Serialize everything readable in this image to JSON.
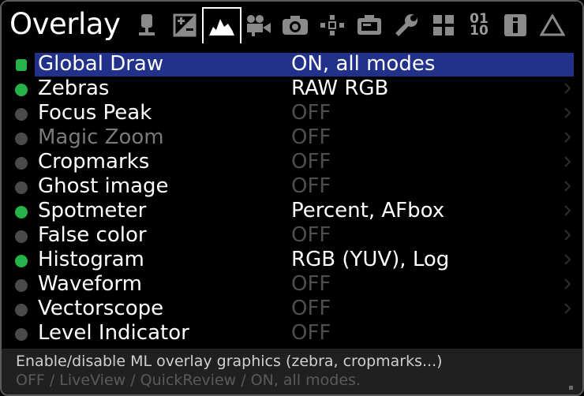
{
  "header": {
    "title": "Overlay",
    "tabs": [
      {
        "name": "audio-mic-icon"
      },
      {
        "name": "exposure-icon"
      },
      {
        "name": "overlay-histogram-icon",
        "active": true
      },
      {
        "name": "movie-camera-icon"
      },
      {
        "name": "photo-camera-icon"
      },
      {
        "name": "focus-icon"
      },
      {
        "name": "display-icon"
      },
      {
        "name": "wrench-icon"
      },
      {
        "name": "modules-icon"
      },
      {
        "name": "debug-icon",
        "text_top": "01",
        "text_bottom": "10"
      },
      {
        "name": "info-icon",
        "text": "i"
      },
      {
        "name": "warning-icon"
      }
    ]
  },
  "menu": {
    "items": [
      {
        "label": "Global Draw",
        "value": "ON, all modes",
        "state": "on-square",
        "selected": true
      },
      {
        "label": "Zebras",
        "value": "RAW RGB",
        "state": "on"
      },
      {
        "label": "Focus Peak",
        "value": "OFF",
        "state": "off"
      },
      {
        "label": "Magic Zoom",
        "value": "OFF",
        "state": "off",
        "disabled": true
      },
      {
        "label": "Cropmarks",
        "value": "OFF",
        "state": "off"
      },
      {
        "label": "Ghost image",
        "value": "OFF",
        "state": "off"
      },
      {
        "label": "Spotmeter",
        "value": "Percent, AFbox",
        "state": "on"
      },
      {
        "label": "False color",
        "value": "OFF",
        "state": "off"
      },
      {
        "label": "Histogram",
        "value": "RGB (YUV), Log",
        "state": "on"
      },
      {
        "label": "Waveform",
        "value": "OFF",
        "state": "off"
      },
      {
        "label": "Vectorscope",
        "value": "OFF",
        "state": "off"
      },
      {
        "label": "Level Indicator",
        "value": "OFF",
        "state": "off"
      }
    ]
  },
  "footer": {
    "help_text": "Enable/disable ML overlay graphics (zebra, cropmarks...)",
    "options_text": "OFF / LiveView / QuickReview / ON, all modes."
  },
  "colors": {
    "selection": "#22318a",
    "on_indicator": "#26b249",
    "off_indicator": "#4a4a4a"
  }
}
